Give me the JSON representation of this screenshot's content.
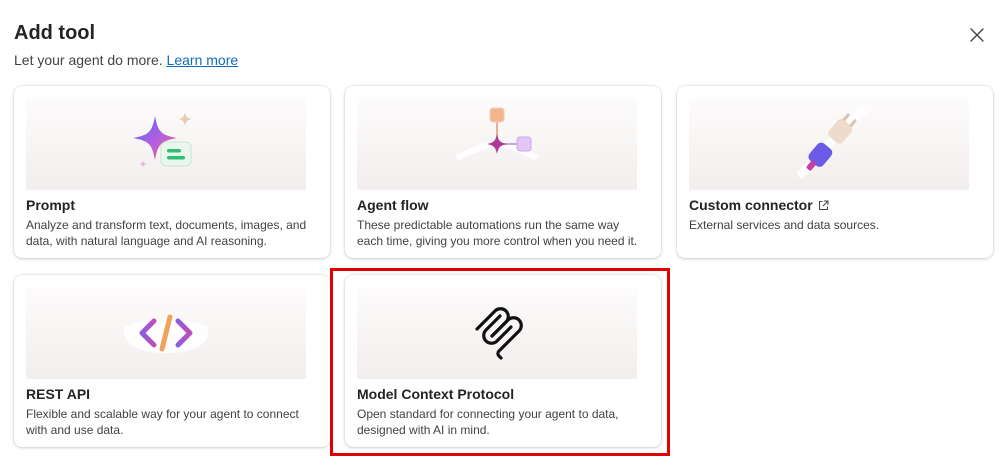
{
  "dialog": {
    "title": "Add tool",
    "subtitle": "Let your agent do more.",
    "learn_more": "Learn more",
    "close_icon": "close-icon"
  },
  "cards": [
    {
      "title": "Prompt",
      "description": "Analyze and transform text, documents, images, and data, with natural language and AI reasoning.",
      "icon": "sparkle-prompt-icon"
    },
    {
      "title": "Agent flow",
      "description": "These predictable automations run the same way each time, giving you more control when you need it.",
      "icon": "flow-icon"
    },
    {
      "title": "Custom connector",
      "description": "External services and data sources.",
      "icon": "plug-icon",
      "external_icon": "open-external-icon"
    },
    {
      "title": "REST API",
      "description": "Flexible and scalable way for your agent to connect with and use data.",
      "icon": "code-icon"
    },
    {
      "title": "Model Context Protocol",
      "description": "Open standard for connecting your agent to data, designed with AI in mind.",
      "icon": "mcp-icon",
      "selected": true
    }
  ],
  "colors": {
    "link": "#0f6cbd",
    "highlight": "#e00000"
  }
}
